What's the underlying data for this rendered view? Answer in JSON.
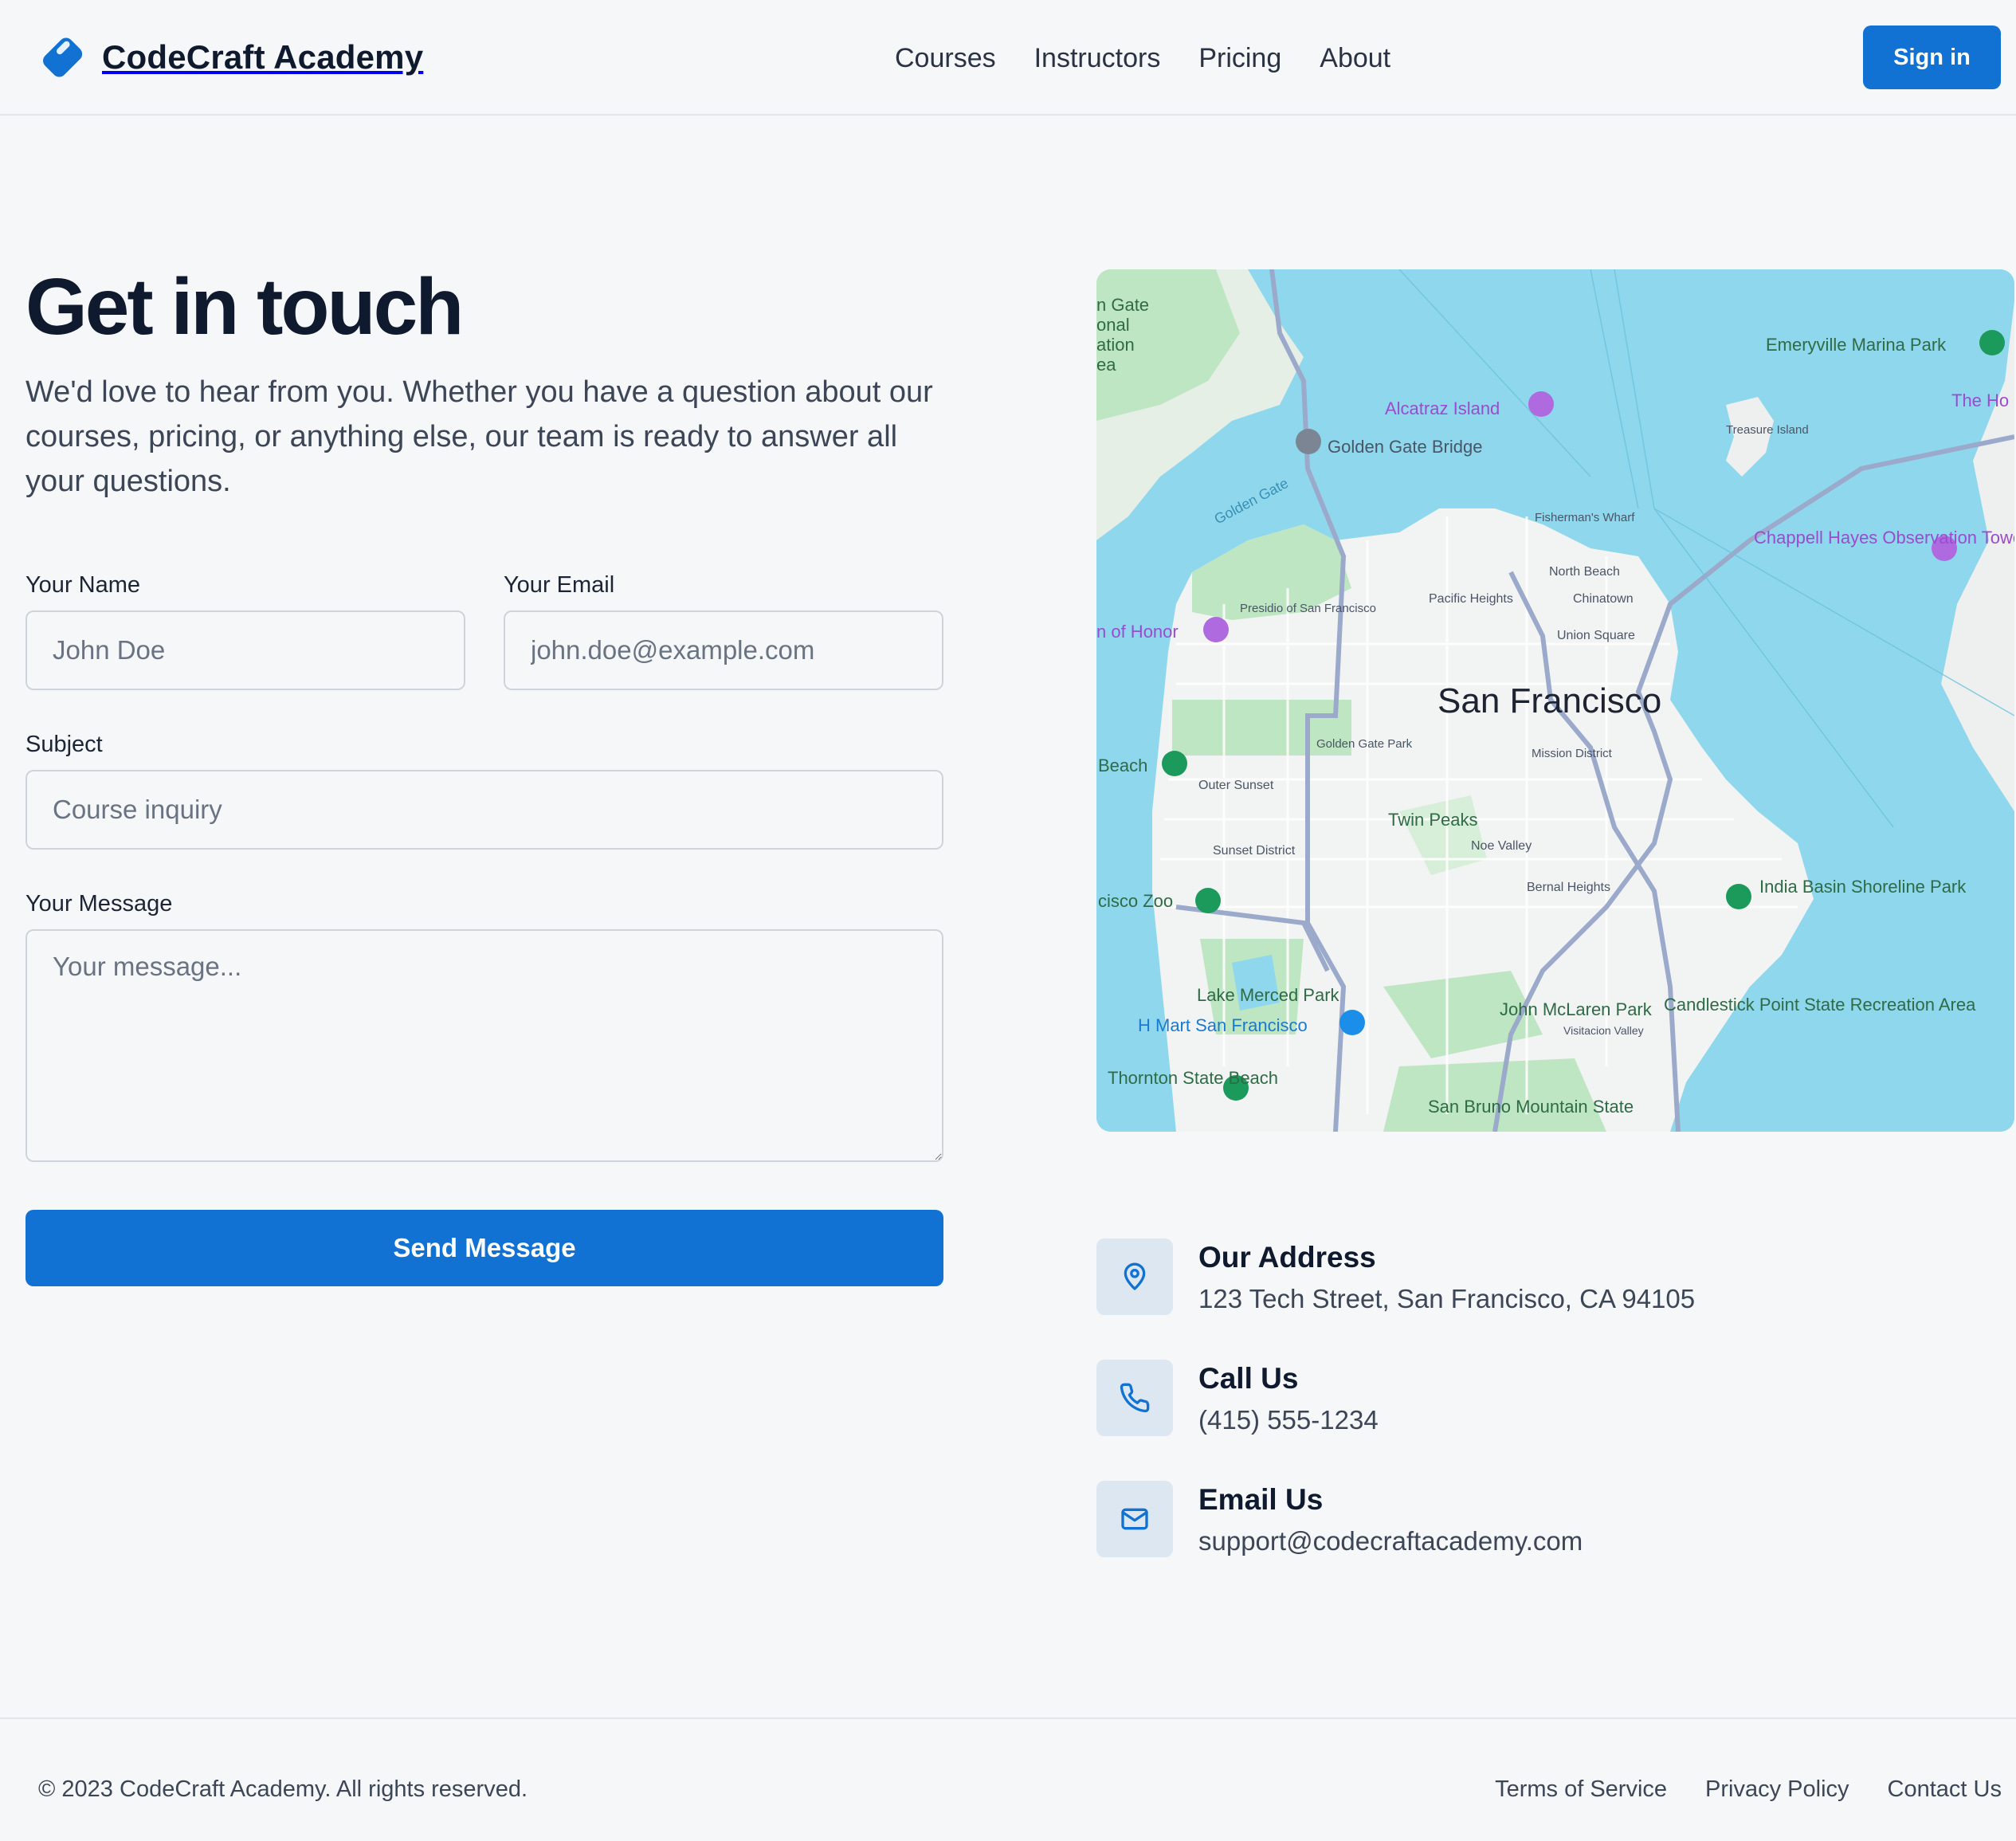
{
  "brand": {
    "name": "CodeCraft Academy",
    "icon": "tag-icon",
    "color": "#1272d3"
  },
  "nav": {
    "items": [
      "Courses",
      "Instructors",
      "Pricing",
      "About"
    ]
  },
  "header": {
    "signin_label": "Sign in"
  },
  "hero": {
    "title": "Get in touch",
    "subtitle": "We'd love to hear from you. Whether you have a question about our courses, pricing, or anything else, our team is ready to answer all your questions."
  },
  "form": {
    "name": {
      "label": "Your Name",
      "placeholder": "John Doe",
      "value": ""
    },
    "email": {
      "label": "Your Email",
      "placeholder": "john.doe@example.com",
      "value": ""
    },
    "subject": {
      "label": "Subject",
      "placeholder": "Course inquiry",
      "value": ""
    },
    "message": {
      "label": "Your Message",
      "placeholder": "Your message...",
      "value": ""
    },
    "submit_label": "Send Message"
  },
  "map": {
    "city_label": "San Francisco",
    "places": [
      "Golden Gate Bridge",
      "Alcatraz Island",
      "Emeryville Marina Park",
      "The Ho",
      "Treasure Island",
      "Fisherman's Wharf",
      "North Beach",
      "Chinatown",
      "Pacific Heights",
      "Union Square",
      "Presidio of San Francisco",
      "Chappell Hayes Observation Tower",
      "Golden Gate Park",
      "Mission District",
      "Outer Sunset",
      "Twin Peaks",
      "Noe Valley",
      "Sunset District",
      "Bernal Heights",
      "India Basin Shoreline Park",
      "Lake Merced Park",
      "John McLaren Park",
      "Visitacion Valley",
      "Candlestick Point State Recreation Area",
      "H Mart San Francisco",
      "Thornton State Beach",
      "San Bruno Mountain State",
      "Golden Gate",
      "n of Honor",
      "Beach",
      "cisco Zoo",
      "n Gate",
      "onal",
      "ation",
      "ea"
    ],
    "water_color": "#8fd7ec",
    "land_color": "#f2f3f3",
    "park_color": "#bfe6c2"
  },
  "contact": {
    "address": {
      "title": "Our Address",
      "text": "123 Tech Street, San Francisco, CA 94105",
      "icon": "map-pin-icon"
    },
    "phone": {
      "title": "Call Us",
      "text": "(415) 555-1234",
      "icon": "phone-icon"
    },
    "email": {
      "title": "Email Us",
      "text": "support@codecraftacademy.com",
      "icon": "mail-icon"
    }
  },
  "footer": {
    "copyright": "© 2023 CodeCraft Academy. All rights reserved.",
    "links": [
      "Terms of Service",
      "Privacy Policy",
      "Contact Us"
    ]
  }
}
